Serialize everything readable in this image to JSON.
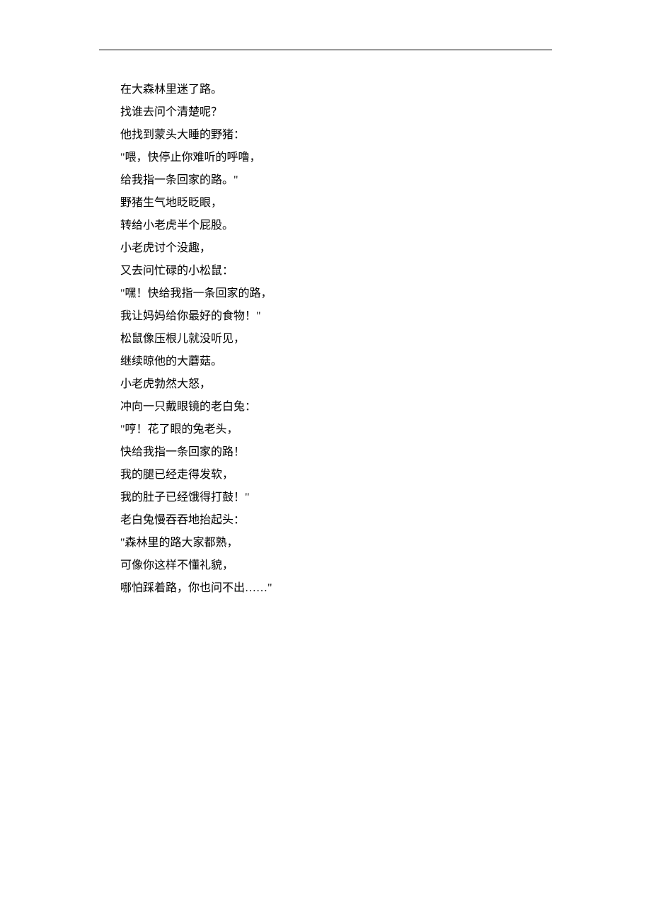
{
  "poem": {
    "lines": [
      "在大森林里迷了路。",
      "找谁去问个清楚呢？",
      "他找到蒙头大睡的野猪：",
      "\"喂，快停止你难听的呼噜，",
      "给我指一条回家的路。\"",
      "野猪生气地眨眨眼，",
      "转给小老虎半个屁股。",
      "小老虎讨个没趣，",
      "又去问忙碌的小松鼠：",
      "\"嘿！快给我指一条回家的路，",
      "我让妈妈给你最好的食物！\"",
      "松鼠像压根儿就没听见，",
      "继续晾他的大蘑菇。",
      "小老虎勃然大怒，",
      "冲向一只戴眼镜的老白兔：",
      "\"哼！花了眼的兔老头，",
      "快给我指一条回家的路！",
      "我的腿已经走得发软，",
      "我的肚子已经饿得打鼓！\"",
      "老白兔慢吞吞地抬起头：",
      "\"森林里的路大家都熟，",
      "可像你这样不懂礼貌，",
      "哪怕踩着路，你也问不出……\""
    ]
  }
}
